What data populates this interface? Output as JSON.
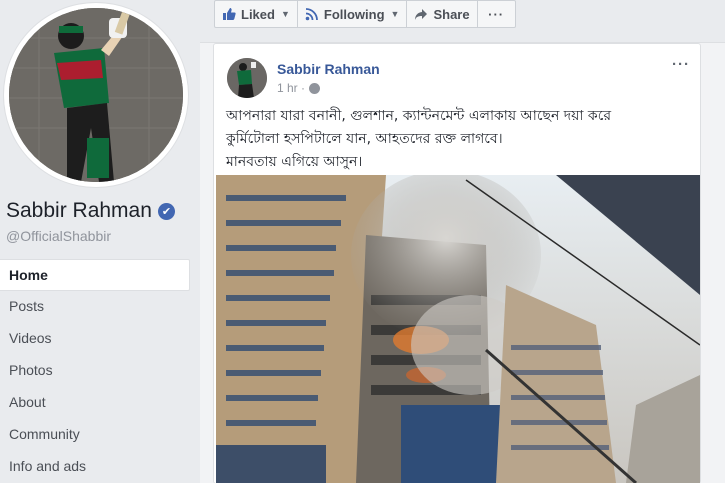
{
  "profile": {
    "name": "Sabbir Rahman",
    "handle": "@OfficialShabbir",
    "verified_mark": "✔"
  },
  "nav": {
    "items": [
      {
        "label": "Home",
        "active": true
      },
      {
        "label": "Posts"
      },
      {
        "label": "Videos"
      },
      {
        "label": "Photos"
      },
      {
        "label": "About"
      },
      {
        "label": "Community"
      },
      {
        "label": "Info and ads"
      }
    ]
  },
  "actions": {
    "liked_label": "Liked",
    "following_label": "Following",
    "share_label": "Share",
    "more_label": "···"
  },
  "post": {
    "author": "Sabbir Rahman",
    "time": "1 hr ·",
    "more_label": "···",
    "text_line1": "আপনারা যারা বনানী, গুলশান, ক্যান্টনমেন্ট এলাকায় আছেন দয়া করে",
    "text_line2": "কুর্মিটোলা হসপিটালে যান, আহতদের রক্ত লাগবে।",
    "text_line3": "মানবতায় এগিয়ে আসুন।"
  },
  "colors": {
    "link_blue": "#385898",
    "fb_blue": "#4267b2",
    "background": "#e9ebee"
  }
}
